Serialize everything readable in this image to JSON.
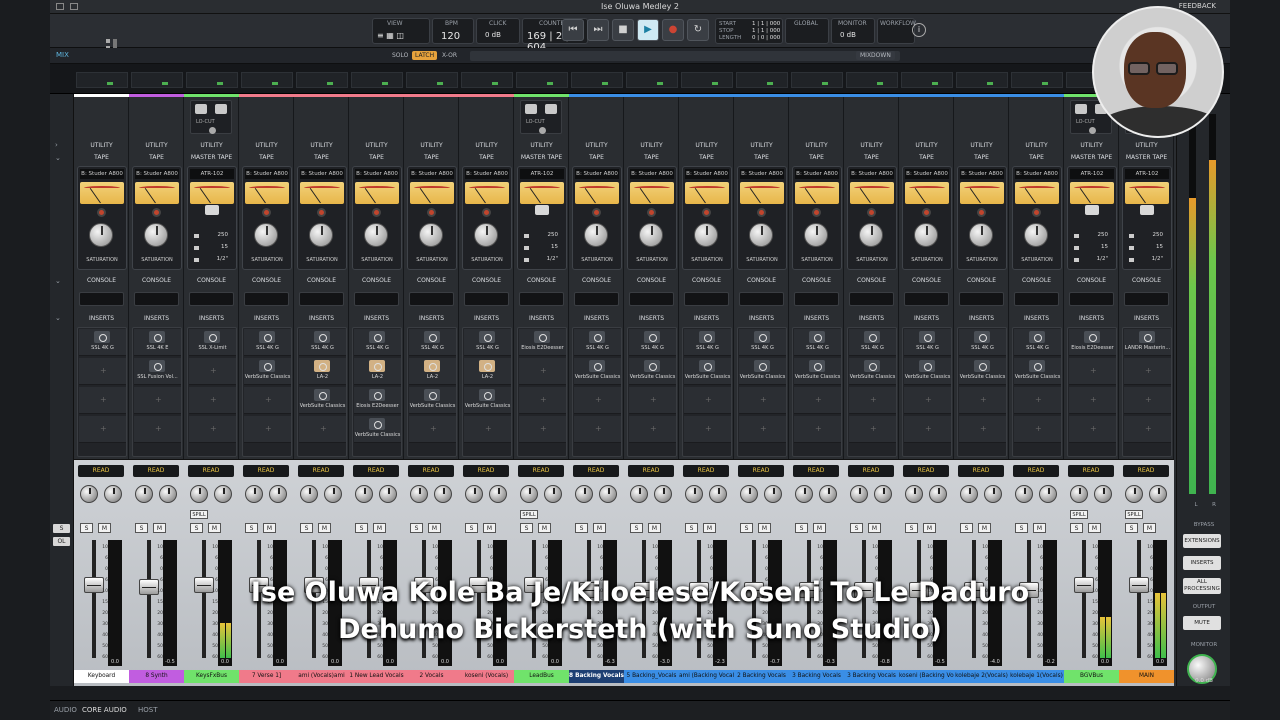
{
  "window": {
    "song_title": "Ise Oluwa Medley 2",
    "feedback_label": "FEEDBACK"
  },
  "transport": {
    "view_label": "VIEW",
    "bpm_label": "BPM",
    "bpm_value": "120",
    "click_label": "CLICK",
    "click_value": "0 dB",
    "counter_label": "COUNTER",
    "counter_value": "169 | 2 | 604",
    "start_label": "START",
    "stop_label": "STOP",
    "length_label": "LENGTH",
    "start_value": "1 | 1 | 000",
    "stop_value": "1 | 1 | 000",
    "length_value": "0 | 0 | 000",
    "global_label": "GLOBAL",
    "monitor_label": "MONITOR",
    "monitor_value": "0 dB",
    "workflow_label": "WORKFLOW"
  },
  "mixbar": {
    "mix_label": "MIX",
    "solo_label": "SOLO",
    "latch_label": "LATCH",
    "xor_label": "X-OR",
    "mixdown_label": "MIXDOWN"
  },
  "sections": {
    "utility": "UTILITY",
    "console": "CONSOLE",
    "inserts": "INSERTS",
    "read": "READ",
    "saturation": "SATURATION",
    "lo_cut": "LO-CUT",
    "spill": "SPILL"
  },
  "channels": [
    {
      "name": "Keyboard",
      "color": "#ffffff",
      "tape": "TAPE",
      "tape_model": "B: Studer A800",
      "kind": "tape",
      "inserts": [
        "SSL 4K G"
      ],
      "db": "0.0",
      "pan_level": 0.15,
      "fader": 0.62,
      "meter": 0
    },
    {
      "name": "8 Synth",
      "color": "#c15de0",
      "tape": "TAPE",
      "tape_model": "B: Studer A800",
      "kind": "tape",
      "inserts": [
        "SSL 4K E",
        "SSL Fusion Vol..."
      ],
      "db": "-0.5",
      "pan_level": 0.15,
      "fader": 0.6,
      "meter": 0
    },
    {
      "name": "KeysFxBus",
      "color": "#70e36b",
      "tape": "MASTER TAPE",
      "tape_model": "ATR-102",
      "kind": "master",
      "inserts": [
        "SSL X-Limit"
      ],
      "db": "0.0",
      "pan_level": 0.15,
      "fader": 0.62,
      "meter": 0.3,
      "spill": true
    },
    {
      "name": "7 Verse 1]",
      "color": "#f07a8a",
      "tape": "TAPE",
      "tape_model": "B: Studer A800",
      "kind": "tape",
      "inserts": [
        "SSL 4K G",
        "VerbSuite Classics"
      ],
      "db": "0.0",
      "pan_level": 0.15,
      "fader": 0.62,
      "meter": 0
    },
    {
      "name": "ami (Vocals)ami",
      "color": "#f07a8a",
      "tape": "TAPE",
      "tape_model": "B: Studer A800",
      "kind": "tape",
      "inserts": [
        "SSL 4K G",
        "LA-2",
        "VerbSuite Classics"
      ],
      "db": "0.0",
      "pan_level": 0.15,
      "fader": 0.62,
      "meter": 0
    },
    {
      "name": "1 New Lead Vocals",
      "color": "#f07a8a",
      "tape": "TAPE",
      "tape_model": "B: Studer A800",
      "kind": "tape",
      "inserts": [
        "SSL 4K G",
        "LA-2",
        "Eiosis E2Deesser",
        "VerbSuite Classics"
      ],
      "db": "0.0",
      "pan_level": 0.15,
      "fader": 0.62,
      "meter": 0
    },
    {
      "name": "2 Vocals",
      "color": "#f07a8a",
      "tape": "TAPE",
      "tape_model": "B: Studer A800",
      "kind": "tape",
      "inserts": [
        "SSL 4K G",
        "LA-2",
        "VerbSuite Classics"
      ],
      "db": "0.0",
      "pan_level": 0.15,
      "fader": 0.62,
      "meter": 0
    },
    {
      "name": "koseni (Vocals)",
      "color": "#f07a8a",
      "tape": "TAPE",
      "tape_model": "B: Studer A800",
      "kind": "tape",
      "inserts": [
        "SSL 4K G",
        "LA-2",
        "VerbSuite Classics"
      ],
      "db": "0.0",
      "pan_level": 0.15,
      "fader": 0.62,
      "meter": 0
    },
    {
      "name": "LeadBus",
      "color": "#70e36b",
      "tape": "MASTER TAPE",
      "tape_model": "ATR-102",
      "kind": "master",
      "inserts": [
        "Eiosis E2Deesser"
      ],
      "db": "0.0",
      "pan_level": 0.15,
      "fader": 0.62,
      "meter": 0,
      "spill": true
    },
    {
      "name": "8 Backing Vocals",
      "color": "#3a8ee6",
      "tape": "TAPE",
      "tape_model": "B: Studer A800",
      "kind": "tape",
      "inserts": [
        "SSL 4K G",
        "VerbSuite Classics"
      ],
      "db": "-6.3",
      "pan_level": 0.15,
      "fader": 0.58,
      "meter": 0,
      "selected": true
    },
    {
      "name": "5 Backing_Vocals",
      "color": "#3a8ee6",
      "tape": "TAPE",
      "tape_model": "B: Studer A800",
      "kind": "tape",
      "inserts": [
        "SSL 4K G",
        "VerbSuite Classics"
      ],
      "db": "-3.0",
      "pan_level": 0.15,
      "fader": 0.58,
      "meter": 0
    },
    {
      "name": "ami (Backing Vocals)",
      "color": "#3a8ee6",
      "tape": "TAPE",
      "tape_model": "B: Studer A800",
      "kind": "tape",
      "inserts": [
        "SSL 4K G",
        "VerbSuite Classics"
      ],
      "db": "-2.3",
      "pan_level": 0.15,
      "fader": 0.58,
      "meter": 0
    },
    {
      "name": "2 Backing Vocals",
      "color": "#3a8ee6",
      "tape": "TAPE",
      "tape_model": "B: Studer A800",
      "kind": "tape",
      "inserts": [
        "SSL 4K G",
        "VerbSuite Classics"
      ],
      "db": "-0.7",
      "pan_level": 0.15,
      "fader": 0.58,
      "meter": 0
    },
    {
      "name": "3 Backing Vocals",
      "color": "#3a8ee6",
      "tape": "TAPE",
      "tape_model": "B: Studer A800",
      "kind": "tape",
      "inserts": [
        "SSL 4K G",
        "VerbSuite Classics"
      ],
      "db": "-0.3",
      "pan_level": 0.15,
      "fader": 0.58,
      "meter": 0
    },
    {
      "name": "3 Backing Vocals",
      "color": "#3a8ee6",
      "tape": "TAPE",
      "tape_model": "B: Studer A800",
      "kind": "tape",
      "inserts": [
        "SSL 4K G",
        "VerbSuite Classics"
      ],
      "db": "-0.8",
      "pan_level": 0.15,
      "fader": 0.58,
      "meter": 0
    },
    {
      "name": "koseni (Backing Vocals)",
      "color": "#3a8ee6",
      "tape": "TAPE",
      "tape_model": "B: Studer A800",
      "kind": "tape",
      "inserts": [
        "SSL 4K G",
        "VerbSuite Classics"
      ],
      "db": "-0.5",
      "pan_level": 0.15,
      "fader": 0.58,
      "meter": 0
    },
    {
      "name": "kolebaje 2(Vocals)",
      "color": "#3a8ee6",
      "tape": "TAPE",
      "tape_model": "B: Studer A800",
      "kind": "tape",
      "inserts": [
        "SSL 4K G",
        "VerbSuite Classics"
      ],
      "db": "-4.0",
      "pan_level": 0.15,
      "fader": 0.58,
      "meter": 0
    },
    {
      "name": "kolebaje 1(Vocals)",
      "color": "#3a8ee6",
      "tape": "TAPE",
      "tape_model": "B: Studer A800",
      "kind": "tape",
      "inserts": [
        "SSL 4K G",
        "VerbSuite Classics"
      ],
      "db": "-0.2",
      "pan_level": 0.15,
      "fader": 0.58,
      "meter": 0
    },
    {
      "name": "BGVBus",
      "color": "#70e36b",
      "tape": "MASTER TAPE",
      "tape_model": "ATR-102",
      "kind": "master",
      "inserts": [
        "Eiosis E2Deesser"
      ],
      "db": "0.0",
      "pan_level": 0.15,
      "fader": 0.62,
      "meter": 0.35,
      "spill": true
    },
    {
      "name": "MAIN",
      "color": "#f0922c",
      "tape": "MASTER TAPE",
      "tape_model": "ATR-102",
      "kind": "master",
      "inserts": [
        "LANDR Masterin..."
      ],
      "db": "0.0",
      "pan_level": 0.15,
      "fader": 0.62,
      "meter": 0.55,
      "spill": true
    }
  ],
  "master_values": [
    "250",
    "15",
    "1/2\""
  ],
  "scale_ticks": [
    "10",
    "6",
    "0",
    "6",
    "10",
    "15",
    "20",
    "30",
    "40",
    "50",
    "60"
  ],
  "right_panel": {
    "bypass_label": "BYPASS",
    "extensions_label": "EXTENSIONS",
    "inserts_label": "INSERTS",
    "all_processing_label": "ALL PROCESSING",
    "output_label": "OUTPUT",
    "mute_label": "MUTE",
    "monitor_label": "MONITOR",
    "monitor_db": "0.0 dB",
    "l_label": "L",
    "r_label": "R",
    "level_left": 0.78,
    "level_right": 0.88
  },
  "statusbar": {
    "audio": "AUDIO",
    "core_audio": "CORE AUDIO",
    "host": "HOST"
  },
  "caption": {
    "line1": "Ise Oluwa Kole Ba Je/Kiloelese/Koseni To Le Daduro",
    "line2": "Dehumo Bickersteth (with Suno Studio)"
  }
}
